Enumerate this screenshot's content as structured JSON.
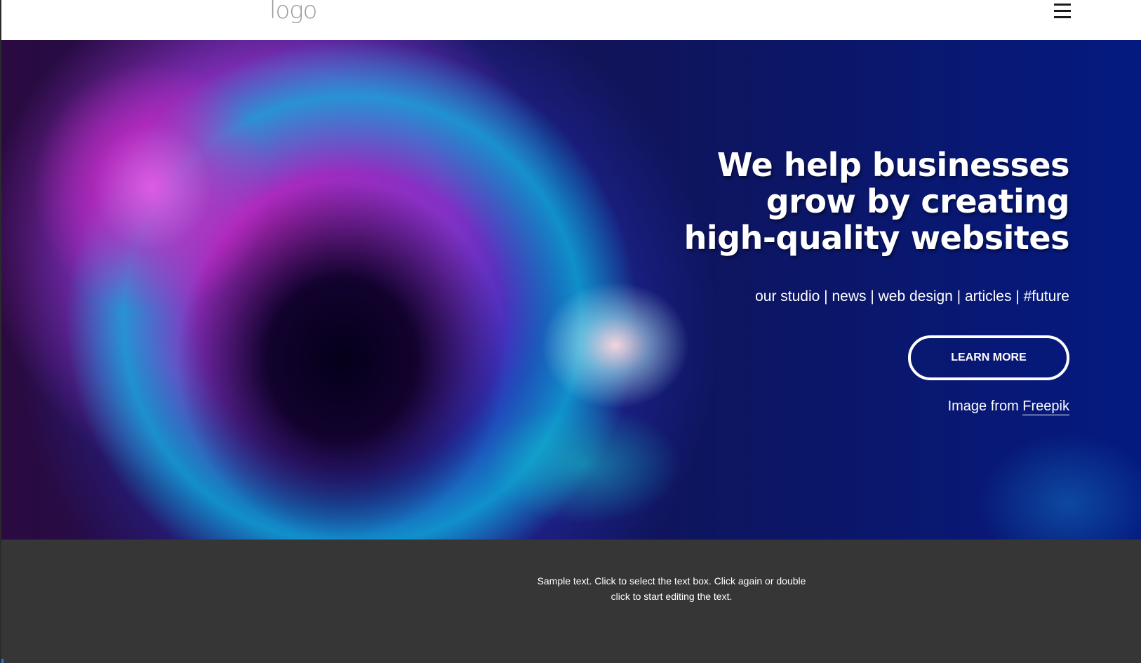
{
  "header": {
    "logo_text": "logo",
    "menu_icon": "hamburger-menu-icon"
  },
  "hero": {
    "headline_line1": "We help businesses",
    "headline_line2": "grow by creating",
    "headline_line3": "high-quality websites",
    "tagline": "our studio | news | web design | articles | #future",
    "button_label": "LEARN MORE",
    "credit_prefix": "Image from ",
    "credit_link": "Freepik"
  },
  "footer": {
    "sample_text": "Sample text. Click to select the text box. Click again or double click to start editing the text."
  },
  "colors": {
    "header_bg": "#ffffff",
    "footer_bg": "#363636",
    "hero_accent_magenta": "#c62fc0",
    "hero_accent_blue": "#041a80",
    "text_light": "#ffffff"
  }
}
